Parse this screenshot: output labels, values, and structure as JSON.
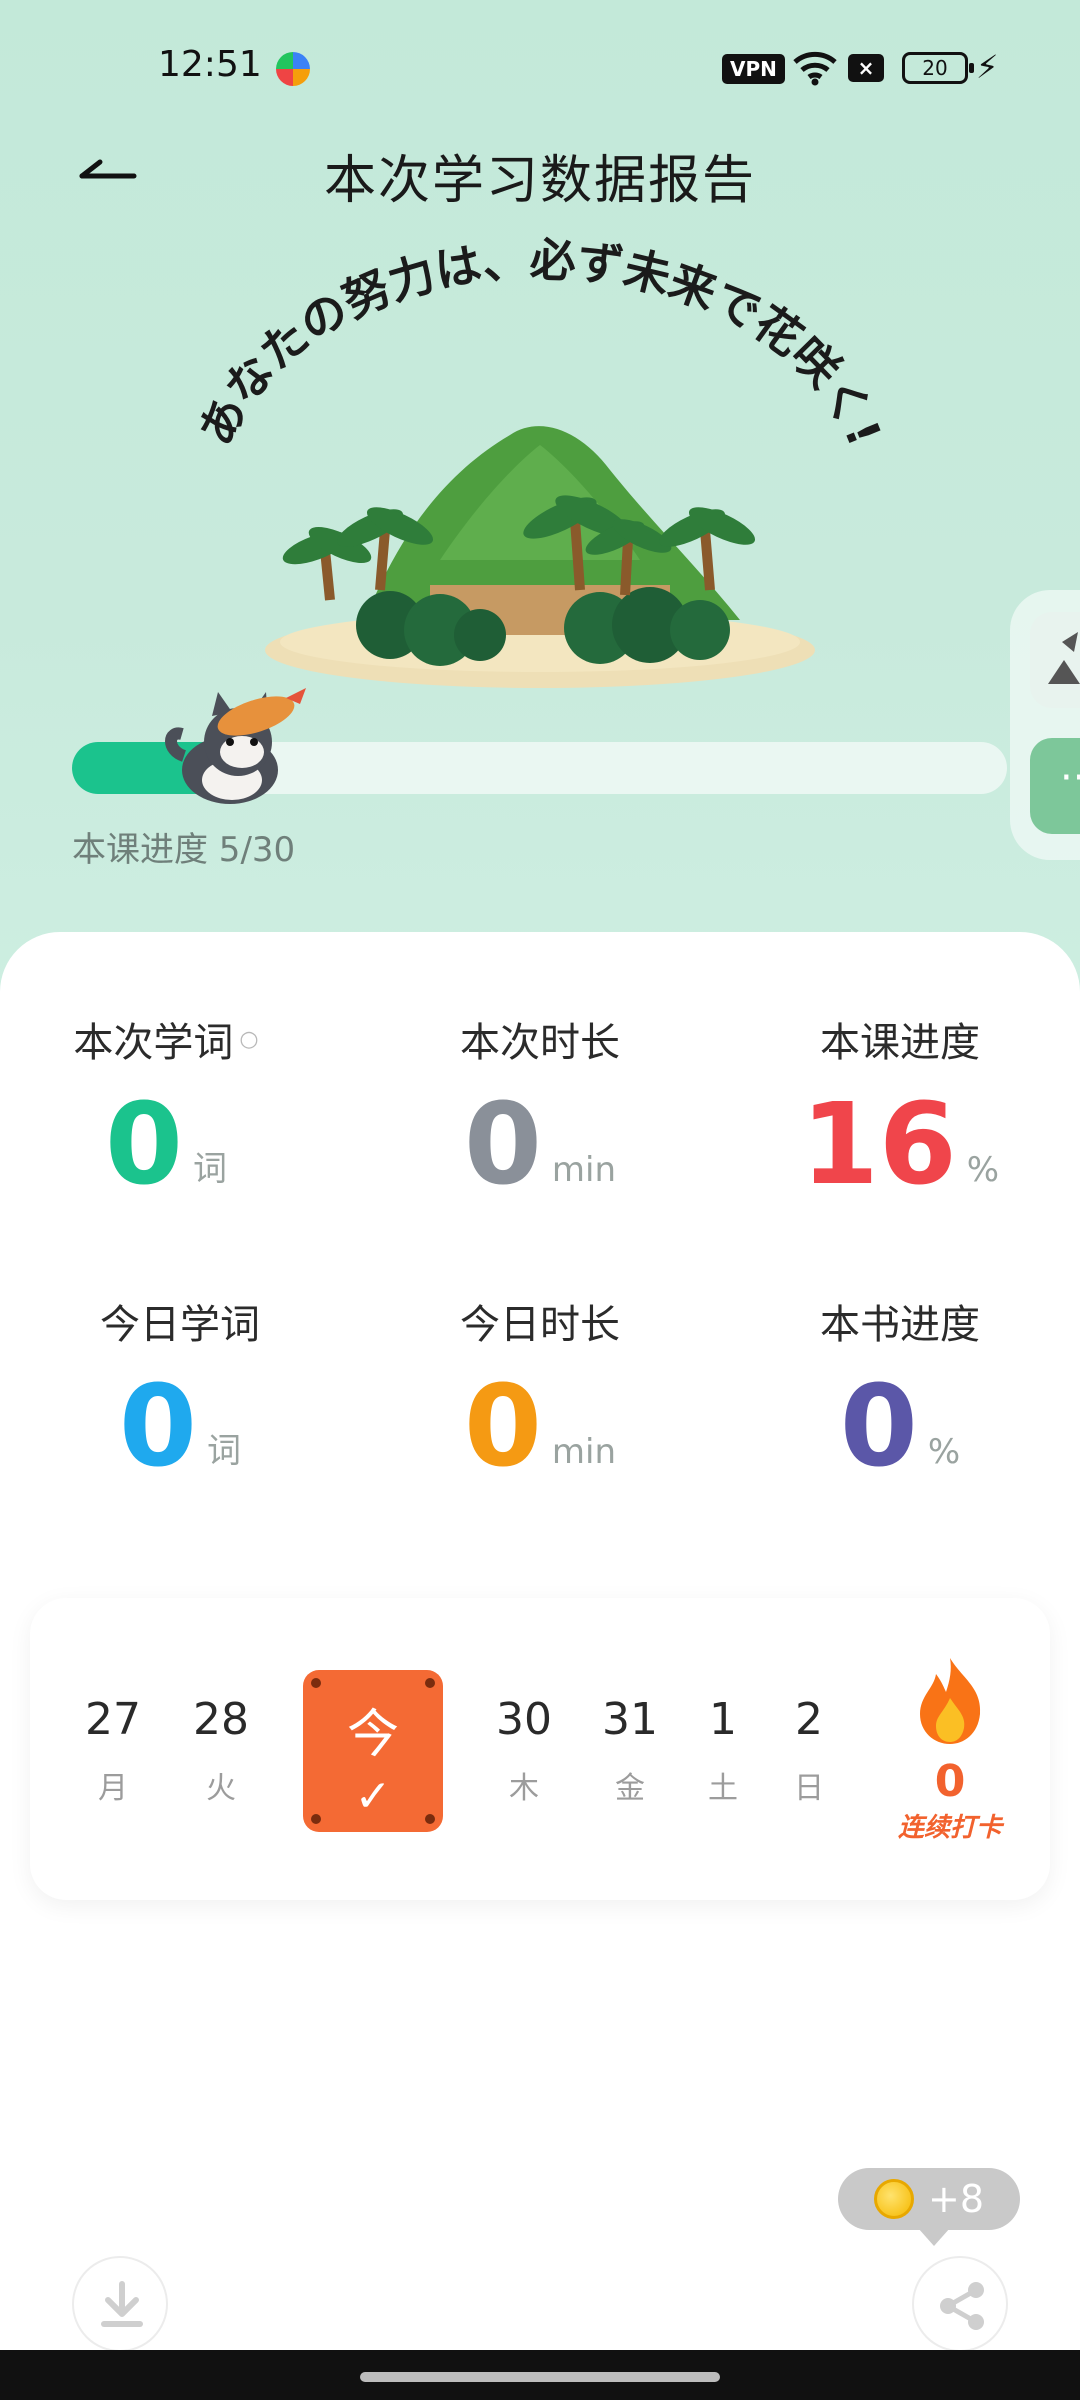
{
  "status_bar": {
    "time": "12:51",
    "vpn": "VPN",
    "battery": "20"
  },
  "header": {
    "title": "本次学习数据报告"
  },
  "hero": {
    "slogan": "あなたの努力は、必ず未来で花咲く!",
    "lesson_progress_label": "本课进度 5/30",
    "progress_fraction": 0.17
  },
  "stats": [
    {
      "label": "本次学词",
      "value": "0",
      "unit": "词",
      "color": "#1bc38d"
    },
    {
      "label": "本次时长",
      "value": "0",
      "unit": "min",
      "color": "#8a9099"
    },
    {
      "label": "本课进度",
      "value": "16",
      "unit": "%",
      "color": "#f0454b"
    },
    {
      "label": "今日学词",
      "value": "0",
      "unit": "词",
      "color": "#1fa9ee"
    },
    {
      "label": "今日时长",
      "value": "0",
      "unit": "min",
      "color": "#f59a13"
    },
    {
      "label": "本书进度",
      "value": "0",
      "unit": "%",
      "color": "#5b57a8"
    }
  ],
  "calendar": {
    "days": [
      {
        "num": "27",
        "wk": "月"
      },
      {
        "num": "28",
        "wk": "火"
      },
      {
        "num": "30",
        "wk": "木"
      },
      {
        "num": "31",
        "wk": "金"
      },
      {
        "num": "1",
        "wk": "土"
      },
      {
        "num": "2",
        "wk": "日"
      }
    ],
    "today_label": "今",
    "streak_count": "0",
    "streak_label": "连续打卡"
  },
  "reward": {
    "coins": "+8"
  }
}
